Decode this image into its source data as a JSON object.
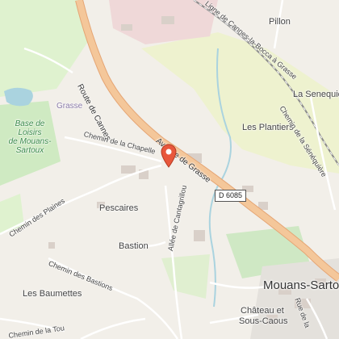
{
  "map": {
    "colors": {
      "background": "#f2efe9",
      "major_road": "#f4c79a",
      "park": "#d6ecc6",
      "water": "#aad3df",
      "marker": "#e8573c"
    },
    "places": {
      "pillon": "Pillon",
      "la_senequier": "La Senequier",
      "les_plantiers": "Les Plantiers",
      "pescaires": "Pescaires",
      "bastion": "Bastion",
      "les_baumettes": "Les Baumettes",
      "chateau_1": "Château et",
      "chateau_2": "Sous-Caous",
      "mouans_sartoux": "Mouans-Sartoux"
    },
    "park_label": [
      "Base de",
      "Loisirs",
      "de Mouans-",
      "Sartoux"
    ],
    "admin_label": "Grasse",
    "roads": {
      "route_de_cannes": "Route de Cannes",
      "avenue_de_grasse": "Avenue de Grasse",
      "chemin_de_la_chapelle": "Chemin de la Chapelle",
      "chemin_des_plaines": "Chemin des Plaines",
      "chemin_des_bastions": "Chemin des Bastions",
      "allee_de_cantagrillou": "Allée de Cantagrillou",
      "chemin_de_la_senequiere": "Chemin de la Sénéquière",
      "ligne_cannes_grasse": "Ligne de Cannes-la-Bocca à Grasse",
      "rue_de_la": "Rue de la",
      "chemin_de_la_t": "Chemin de la Tou",
      "d6085": "D 6085"
    },
    "marker_icon": "map-pin-icon"
  }
}
